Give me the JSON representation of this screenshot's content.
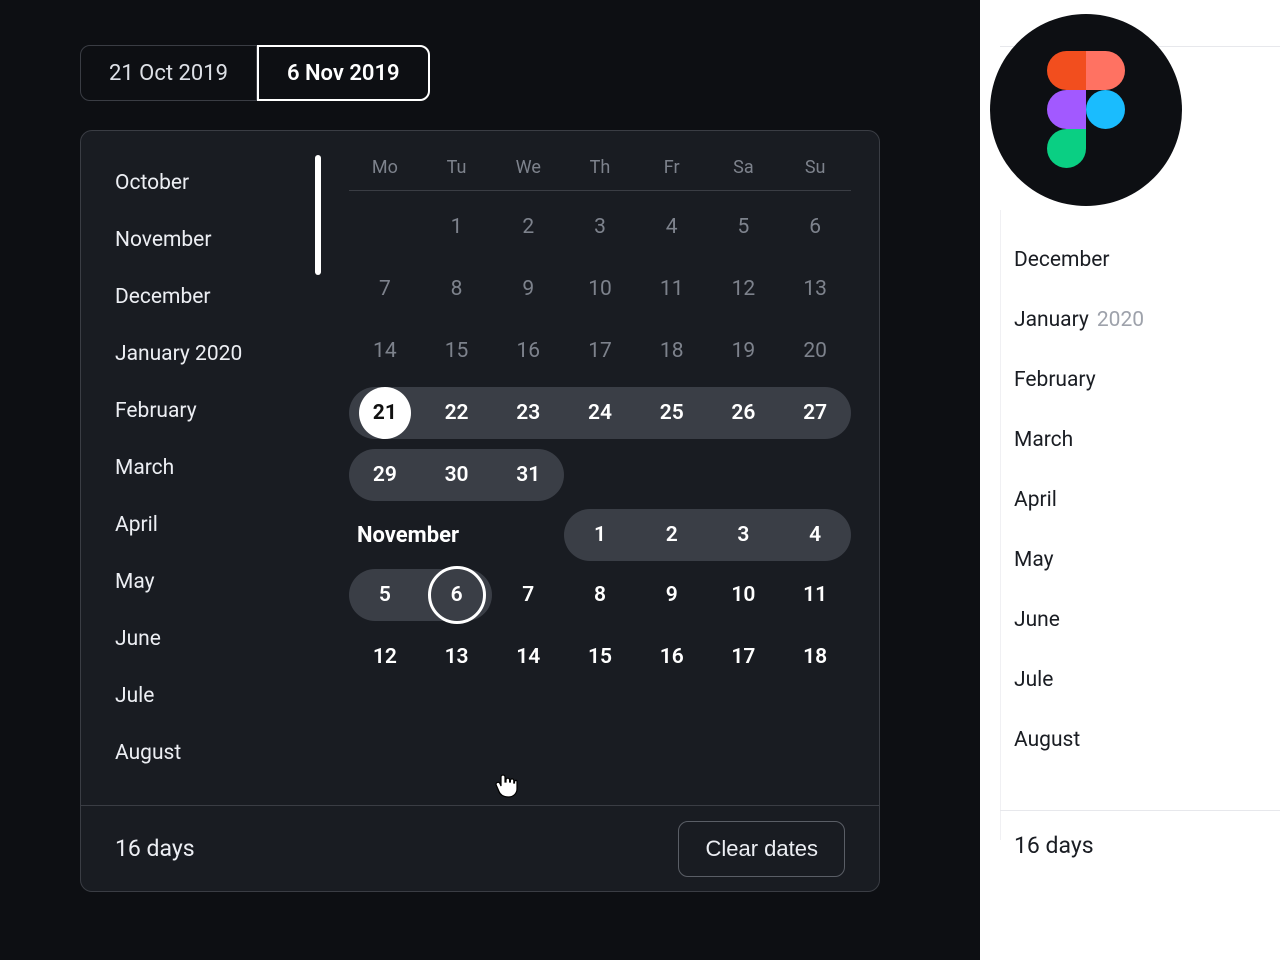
{
  "inputs": {
    "start": "21 Oct 2019",
    "end": "6 Nov 2019"
  },
  "months_dark": [
    "October",
    "November",
    "December",
    "January 2020",
    "February",
    "March",
    "April",
    "May",
    "June",
    "Jule",
    "August"
  ],
  "dow": [
    "Mo",
    "Tu",
    "We",
    "Th",
    "Fr",
    "Sa",
    "Su"
  ],
  "oct_weeks": [
    [
      "1",
      "2",
      "3",
      "4",
      "5",
      "6"
    ],
    [
      "7",
      "8",
      "9",
      "10",
      "11",
      "12",
      "13"
    ],
    [
      "14",
      "15",
      "16",
      "17",
      "18",
      "19",
      "20"
    ],
    [
      "21",
      "22",
      "23",
      "24",
      "25",
      "26",
      "27"
    ],
    [
      "29",
      "30",
      "31"
    ]
  ],
  "nov_label": "November",
  "nov_row1": [
    "1",
    "2",
    "3",
    "4"
  ],
  "nov_row2": [
    "5",
    "6",
    "7",
    "8",
    "9",
    "10",
    "11"
  ],
  "nov_row3": [
    "12",
    "13",
    "14",
    "15",
    "16",
    "17",
    "18"
  ],
  "footer": {
    "duration": "16 days",
    "clear": "Clear dates"
  },
  "months_light": [
    {
      "label": "December"
    },
    {
      "label": "January",
      "year": "2020"
    },
    {
      "label": "February"
    },
    {
      "label": "March"
    },
    {
      "label": "April"
    },
    {
      "label": "May"
    },
    {
      "label": "June"
    },
    {
      "label": "Jule"
    },
    {
      "label": "August"
    }
  ],
  "light_duration": "16 days"
}
